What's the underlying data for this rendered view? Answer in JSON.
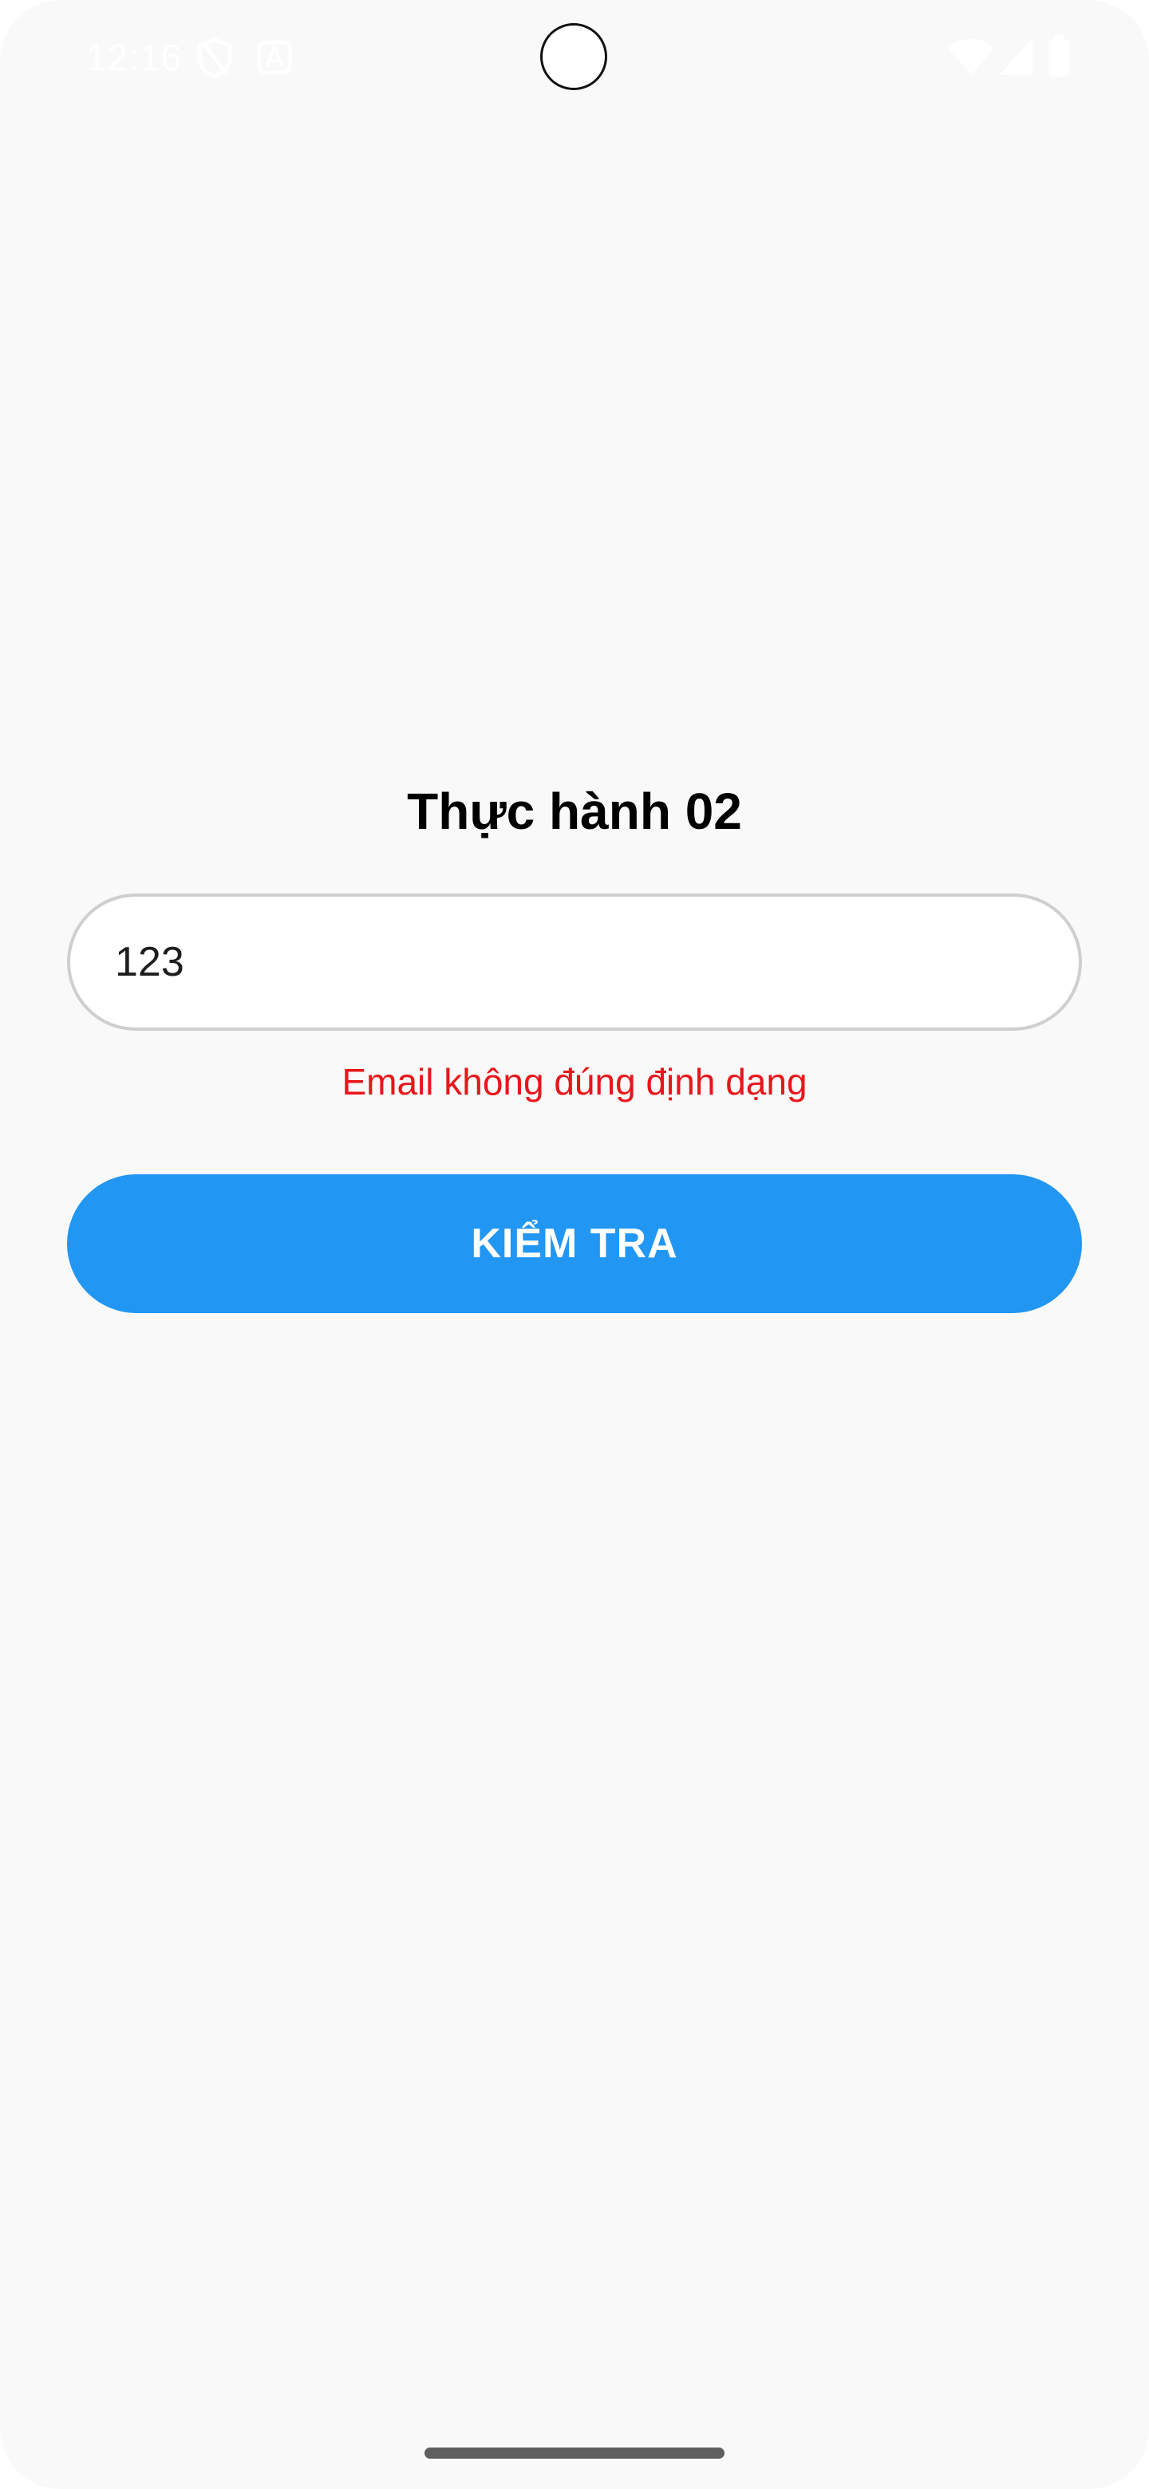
{
  "status_bar": {
    "time": "12:16",
    "icons": [
      "shield-icon",
      "a-badge-icon",
      "wifi-icon",
      "signal-icon",
      "battery-icon"
    ]
  },
  "main": {
    "title": "Thực hành 02",
    "email_input": {
      "value": "123",
      "placeholder": ""
    },
    "error_message": "Email không đúng định dạng",
    "check_button_label": "KIỂM TRA"
  },
  "colors": {
    "background": "#f9f9f9",
    "button": "#2196f3",
    "error": "#e8161b",
    "input_border": "#cfcfcf"
  }
}
